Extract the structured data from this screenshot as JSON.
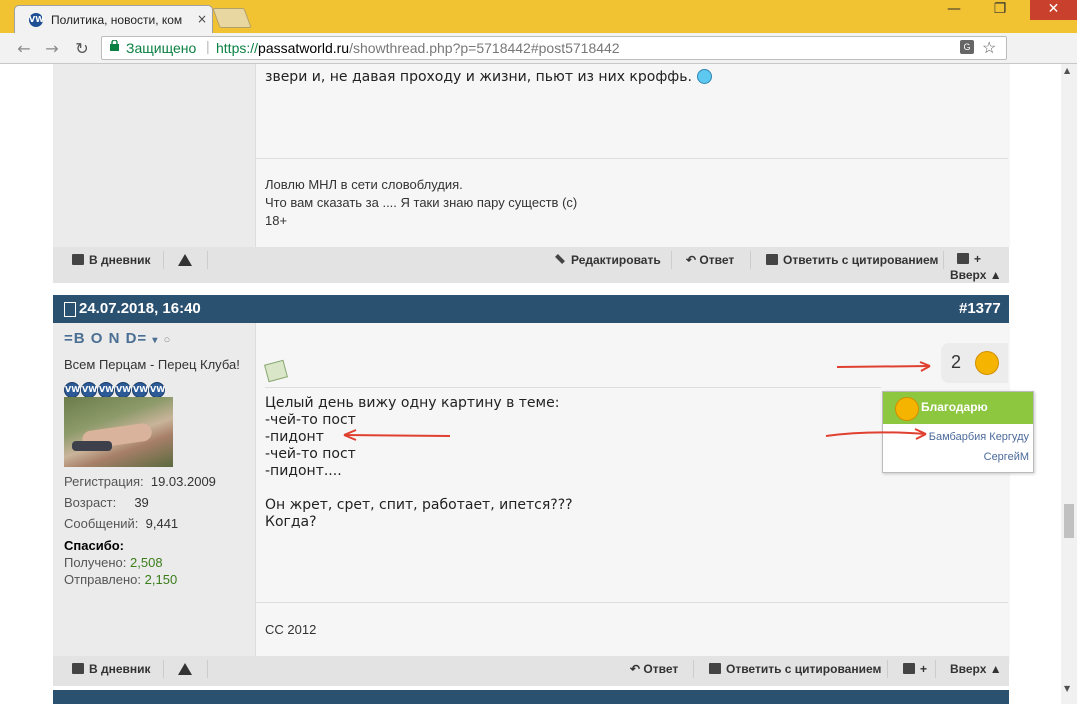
{
  "browser": {
    "tab_title": "Политика, новости, ком",
    "tab_close": "×",
    "favicon_text": "VW",
    "secure_label": "Защищено",
    "url_scheme": "https://",
    "url_host": "passatworld.ru",
    "url_path": "/showthread.php?p=5718442#post5718442",
    "ext_badge": "3",
    "back": "←",
    "forward": "→",
    "reload": "↻",
    "minimize": "—",
    "maximize": "❐",
    "close": "✕",
    "star": "☆",
    "translate": "G"
  },
  "prev_post": {
    "text_last_line": "звери и, не давая проходу и жизни, пьют из них кроффь.",
    "signature": [
      "Ловлю МНЛ в сети словоблудия.",
      "Что вам сказать за .... Я таки знаю пару существ (с)",
      "18+"
    ],
    "footer": {
      "diary": "В дневник",
      "edit": "Редактировать",
      "reply": "Ответ",
      "quote": "Ответить с цитированием",
      "up": "Вверх ▲"
    }
  },
  "post": {
    "date": "24.07.2018, 16:40",
    "number": "#1377",
    "user": {
      "name": "=B O N D=",
      "title": "Всем Перцам - Перец Клуба!",
      "rep_icons": [
        "VW",
        "VW",
        "VW",
        "VW",
        "VW",
        "VW"
      ],
      "registration_label": "Регистрация:",
      "registration": "19.03.2009",
      "age_label": "Возраст:",
      "age": "39",
      "messages_label": "Сообщений:",
      "messages": "9,441",
      "thanks_label": "Спасибо:",
      "received_label": "Получено:",
      "received": "2,508",
      "sent_label": "Отправлено:",
      "sent": "2,150"
    },
    "body_lines": [
      "Целый день вижу одну картину в теме:",
      "-чей-то пост",
      "-пидонт",
      "-чей-то пост",
      "-пидонт....",
      "",
      "Он жрет, срет, спит, работает, ипется???",
      "Когда?"
    ],
    "thanks_count": "2",
    "signature": "CC 2012",
    "footer": {
      "diary": "В дневник",
      "reply": "Ответ",
      "quote": "Ответить с цитированием",
      "up": "Вверх ▲"
    }
  },
  "thanks_popup": {
    "title": "Благодарю",
    "names": [
      "Бамбарбия Кергуду",
      "СергейМ"
    ]
  },
  "colors": {
    "header_blue": "#2b5171",
    "thanks_green": "#8dc63f",
    "annotation_red": "#e04030"
  }
}
